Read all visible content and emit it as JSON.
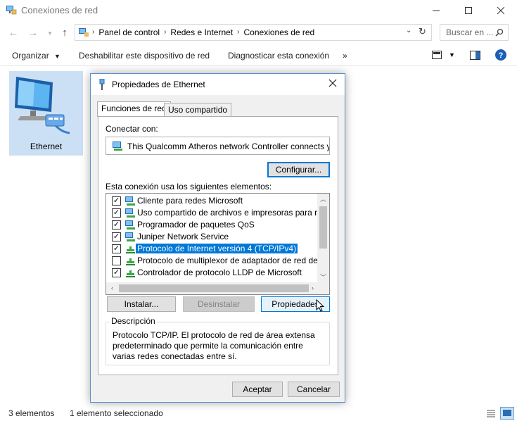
{
  "window": {
    "title": "Conexiones de red"
  },
  "address": {
    "crumbs": [
      "Panel de control",
      "Redes e Internet",
      "Conexiones de red"
    ],
    "search_placeholder": "Buscar en ..."
  },
  "commands": {
    "organize": "Organizar",
    "disable": "Deshabilitar este dispositivo de red",
    "diagnose": "Diagnosticar esta conexión",
    "more": "»"
  },
  "items": [
    {
      "label": "Ethernet"
    }
  ],
  "status": {
    "count": "3 elementos",
    "selected": "1 elemento seleccionado"
  },
  "dialog": {
    "title": "Propiedades de Ethernet",
    "tabs": [
      "Funciones de red",
      "Uso compartido"
    ],
    "connect_with_label": "Conectar con:",
    "adapter_name": "This Qualcomm Atheros network Controller connects you t",
    "configure_button": "Configurar...",
    "elements_label": "Esta conexión usa los siguientes elementos:",
    "elements": [
      {
        "label": "Cliente para redes Microsoft",
        "checked": true,
        "selected": false
      },
      {
        "label": "Uso compartido de archivos e impresoras para redes M",
        "checked": true,
        "selected": false
      },
      {
        "label": "Programador de paquetes QoS",
        "checked": true,
        "selected": false
      },
      {
        "label": "Juniper Network Service",
        "checked": true,
        "selected": false
      },
      {
        "label": "Protocolo de Internet versión 4 (TCP/IPv4)",
        "checked": true,
        "selected": true
      },
      {
        "label": "Protocolo de multiplexor de adaptador de red de Micros",
        "checked": false,
        "selected": false
      },
      {
        "label": "Controlador de protocolo LLDP de Microsoft",
        "checked": true,
        "selected": false
      }
    ],
    "install_button": "Instalar...",
    "uninstall_button": "Desinstalar",
    "properties_button": "Propiedades",
    "description_legend": "Descripción",
    "description_text": "Protocolo TCP/IP. El protocolo de red de área extensa predeterminado que permite la comunicación entre varias redes conectadas entre sí.",
    "ok_button": "Aceptar",
    "cancel_button": "Cancelar"
  },
  "colors": {
    "accent": "#0078d7",
    "selection_tile": "#cce0f5",
    "dialog_border": "#5a8fcf"
  }
}
